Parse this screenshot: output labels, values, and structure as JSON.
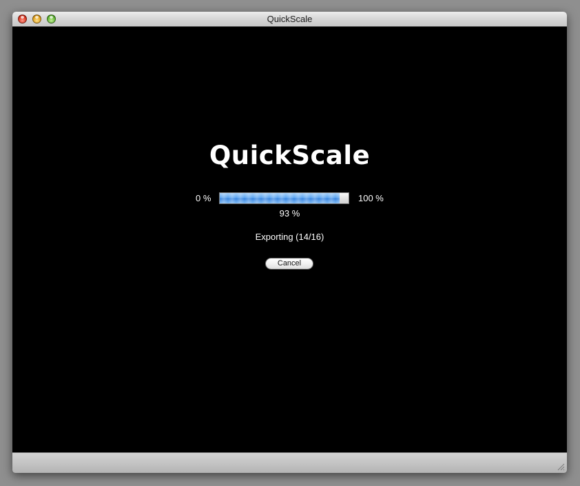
{
  "window": {
    "title": "QuickScale"
  },
  "main": {
    "app_title": "QuickScale",
    "progress": {
      "min_label": "0 %",
      "max_label": "100 %",
      "value_label": "93 %",
      "percent": 93
    },
    "status": "Exporting (14/16)",
    "cancel_label": "Cancel"
  },
  "colors": {
    "content_background": "#000000",
    "progress_fill": "#5ba4f0"
  },
  "icons": {
    "close": "close-icon",
    "minimize": "minimize-icon",
    "zoom": "zoom-icon",
    "resize": "resize-grip-icon"
  }
}
